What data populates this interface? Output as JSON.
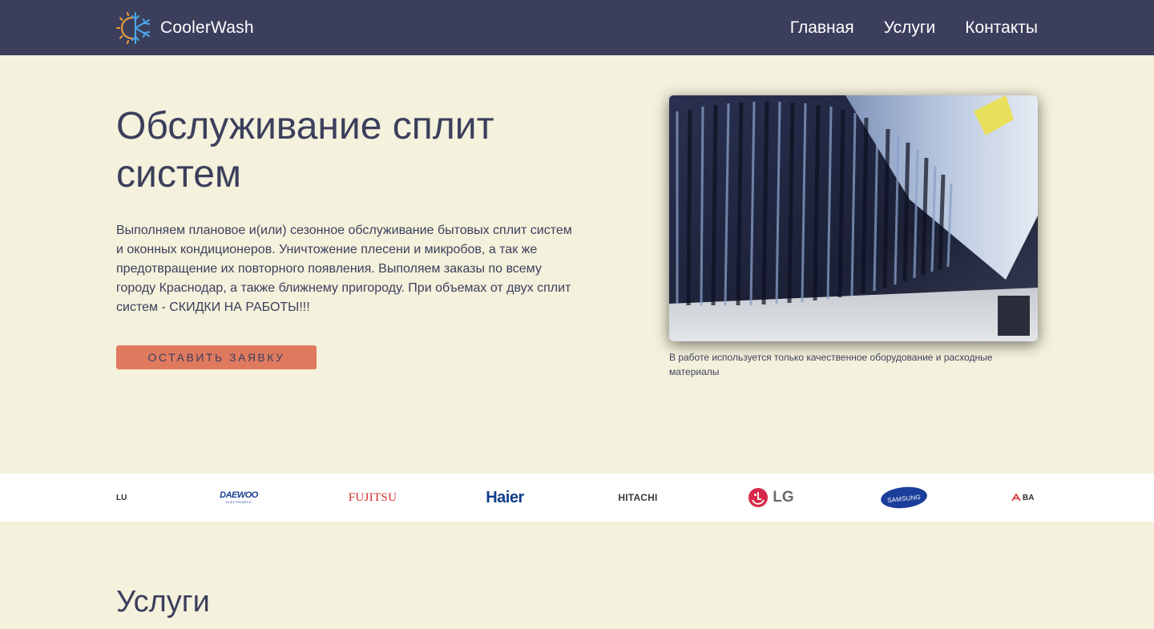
{
  "header": {
    "brand_name": "CoolerWash",
    "logo_icon": "snowflake-sun-icon",
    "nav": [
      {
        "label": "Главная"
      },
      {
        "label": "Услуги"
      },
      {
        "label": "Контакты"
      }
    ]
  },
  "hero": {
    "title": "Обслуживание сплит систем",
    "description": "Выполняем плановое и(или) сезонное обслуживание бытовых сплит систем и оконных кондиционеров. Уничтожение плесени и микробов, а так же предотвращение их повторного появления. Выполяем заказы по всему городу Краснодар, а также ближнему пригороду. При объемах от двух сплит систем - СКИДКИ НА РАБОТЫ!!!",
    "cta_label": "ОСТАВИТЬ ЗАЯВКУ",
    "image_caption": "В работе используется только качественное оборудование и расходные материалы"
  },
  "brands": {
    "items": [
      {
        "label": "LU"
      },
      {
        "label": "DAEWOO",
        "sublabel": "ELECTRONICS"
      },
      {
        "label": "FUJITSU"
      },
      {
        "label": "Haier"
      },
      {
        "label": "HITACHI"
      },
      {
        "label": "LG"
      },
      {
        "label": "SAMSUNG"
      },
      {
        "label": "BA"
      }
    ]
  },
  "services": {
    "title": "Услуги"
  },
  "colors": {
    "header_bg": "#3b3f5c",
    "page_bg": "#f4f1dc",
    "accent": "#e07a5f",
    "text": "#3b3f5c"
  }
}
